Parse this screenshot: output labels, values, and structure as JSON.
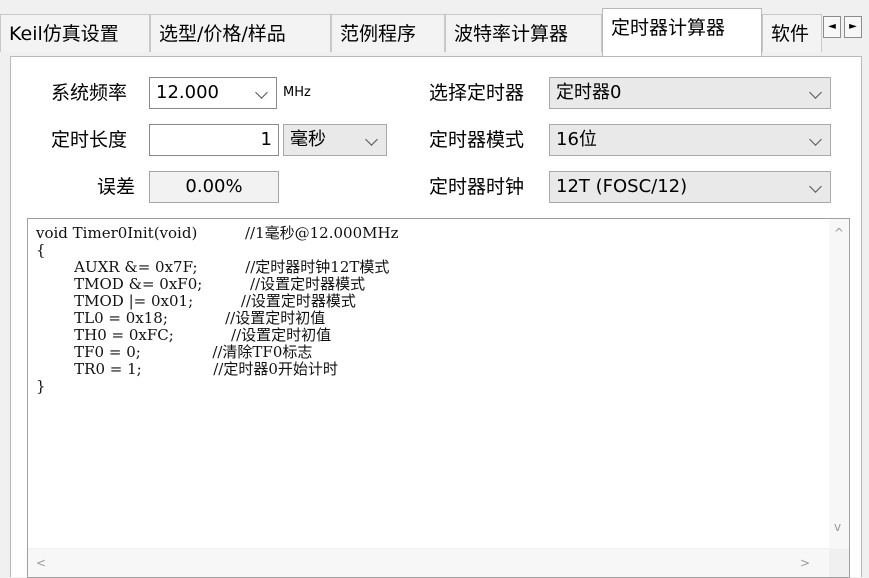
{
  "tabs": [
    {
      "label": "Keil仿真设置",
      "active": false
    },
    {
      "label": "选型/价格/样品",
      "active": false
    },
    {
      "label": "范例程序",
      "active": false
    },
    {
      "label": "波特率计算器",
      "active": false
    },
    {
      "label": "定时器计算器",
      "active": true
    },
    {
      "label": "软件",
      "active": false
    }
  ],
  "tab_scroll": {
    "left": "◄",
    "right": "►"
  },
  "form": {
    "sysfreq_label": "系统频率",
    "sysfreq_value": "12.000",
    "sysfreq_unit": "MHz",
    "length_label": "定时长度",
    "length_value": "1",
    "length_unit": "毫秒",
    "error_label": "误差",
    "error_value": "0.00%",
    "timer_label": "选择定时器",
    "timer_value": "定时器0",
    "mode_label": "定时器模式",
    "mode_value": "16位",
    "clock_label": "定时器时钟",
    "clock_value": "12T (FOSC/12)"
  },
  "code": {
    "lines": [
      "void Timer0Init(void)          //1毫秒@12.000MHz",
      "{",
      "        AUXR &= 0x7F;          //定时器时钟12T模式",
      "        TMOD &= 0xF0;          //设置定时器模式",
      "        TMOD |= 0x01;          //设置定时器模式",
      "        TL0 = 0x18;            //设置定时初值",
      "        TH0 = 0xFC;            //设置定时初值",
      "        TF0 = 0;               //清除TF0标志",
      "        TR0 = 1;               //定时器0开始计时",
      "}"
    ]
  },
  "icons": {
    "chevron": "chevron-down-icon",
    "scroll_up": "^",
    "scroll_down": "v",
    "scroll_left": "<",
    "scroll_right": ">"
  }
}
